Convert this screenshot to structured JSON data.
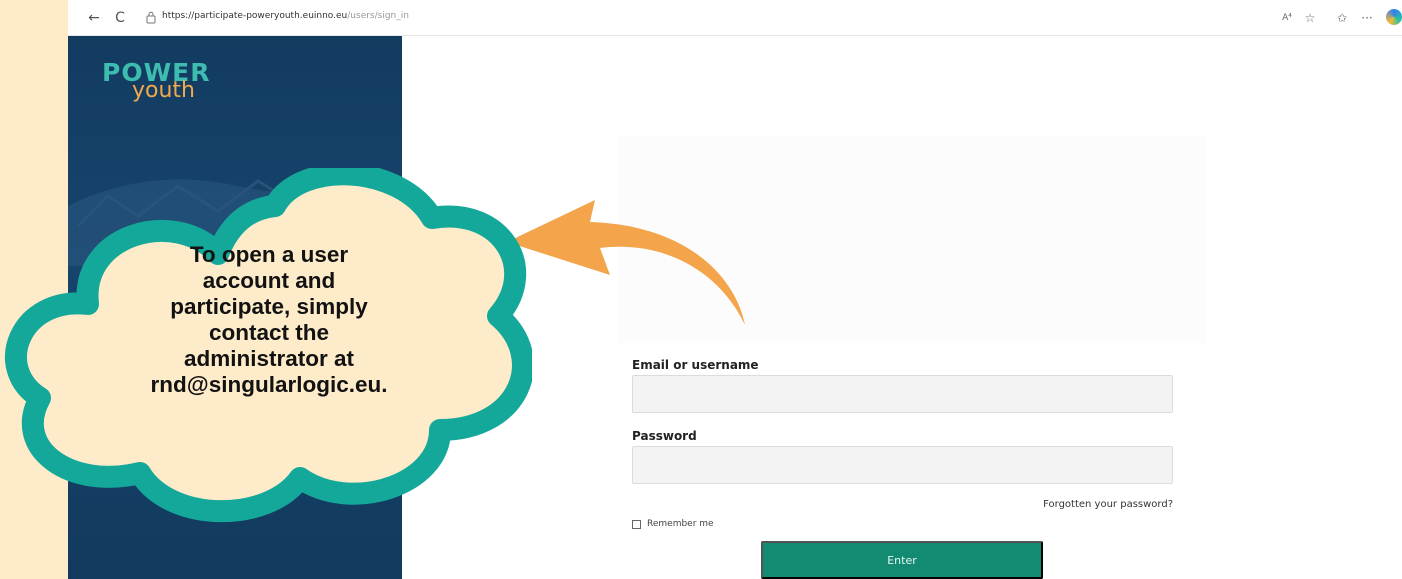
{
  "browser": {
    "url_host": "https://participate-poweryouth.euinno.eu",
    "url_path": "/users/sign_in",
    "icons": [
      "back-arrow-icon",
      "refresh-icon",
      "lock-icon",
      "read-aloud-icon",
      "favorite-star-icon",
      "favorites-list-icon",
      "more-icon",
      "edge-profile-icon"
    ],
    "glyphs": {
      "back": "←",
      "refresh": "C",
      "read_aloud": "A⁴",
      "favorite": "☆",
      "favorites": "✩",
      "more": "···"
    }
  },
  "brand": {
    "logo_top": "POWER",
    "logo_bottom": "youth",
    "panel_color": "#143f66",
    "teal": "#3dbdb0",
    "orange": "#f2a94b"
  },
  "login_form": {
    "email_label": "Email or username",
    "email_value": "",
    "password_label": "Password",
    "password_value": "",
    "forgot_link": "Forgotten your password?",
    "remember_label": "Remember me",
    "remember_checked": false,
    "submit_label": "Enter",
    "submit_color": "#138b73"
  },
  "callout": {
    "lines": [
      "To open a user",
      "account and",
      "participate, simply",
      "contact the",
      "administrator at",
      "rnd@singularlogic.eu."
    ],
    "cloud_fill": "#fdebc9",
    "cloud_border": "#14a89a",
    "arrow_color": "#f4a44a"
  }
}
